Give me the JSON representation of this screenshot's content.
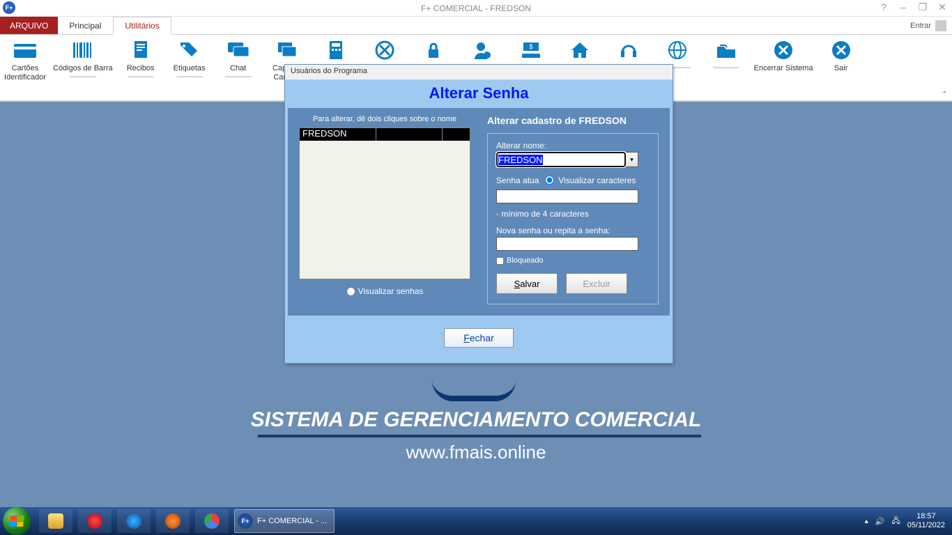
{
  "titlebar": {
    "app_logo": "F+",
    "title": "F+ COMERCIAL - FREDSON"
  },
  "win_controls": {
    "help": "?",
    "min": "–",
    "max": "❐",
    "close": "✕"
  },
  "tabs": {
    "file": "ARQUIVO",
    "principal": "Principal",
    "utilitarios": "Utilitários",
    "signin": "Entrar"
  },
  "ribbon": {
    "items": [
      {
        "label1": "Cartões",
        "label2": "Identificador"
      },
      {
        "label1": "Códigos de Barra",
        "label2": ""
      },
      {
        "label1": "Recibos",
        "label2": ""
      },
      {
        "label1": "Etiquetas",
        "label2": ""
      },
      {
        "label1": "Chat",
        "label2": ""
      },
      {
        "label1": "Capas e",
        "label2": "Cartões"
      },
      {
        "label1": "",
        "label2": ""
      },
      {
        "label1": "",
        "label2": ""
      },
      {
        "label1": "",
        "label2": ""
      },
      {
        "label1": "",
        "label2": ""
      },
      {
        "label1": "",
        "label2": ""
      },
      {
        "label1": "",
        "label2": ""
      },
      {
        "label1": "",
        "label2": ""
      },
      {
        "label1": "",
        "label2": ""
      },
      {
        "label1": "",
        "label2": ""
      },
      {
        "label1": "Encerrar Sistema",
        "label2": ""
      },
      {
        "label1": "Sair",
        "label2": ""
      }
    ],
    "sep": "----------------"
  },
  "splash": {
    "title": "SISTEMA DE GERENCIAMENTO COMERCIAL",
    "url": "www.fmais.online"
  },
  "dialog": {
    "window_title": "Usuários do Programa",
    "heading": "Alterar Senha",
    "left_hint": "Para alterar, dê dois cliques sobre o nome",
    "user_list": [
      {
        "name": "FREDSON"
      }
    ],
    "visualizar_senhas": "Visualizar senhas",
    "form_title_prefix": "Alterar cadastro de ",
    "form_title_user": "FREDSON",
    "lbl_alterar_nome": "Alterar nome:",
    "val_nome": "FREDSON",
    "lbl_senha_atual": "Senha atua",
    "lbl_visualizar_chars": "Visualizar caracteres",
    "note_min": "- mínimo de 4 caracteres",
    "lbl_nova_senha": "Nova senha ou repita a senha:",
    "lbl_bloqueado": "Bloqueado",
    "btn_salvar_u": "S",
    "btn_salvar_rest": "alvar",
    "btn_excluir": "Excluir",
    "btn_fechar_u": "F",
    "btn_fechar_rest": "echar"
  },
  "taskbar": {
    "app_label": "F+ COMERCIAL - ...",
    "time": "18:57",
    "date": "05/11/2022"
  },
  "colors": {
    "ribbon_icon": "#0b7dc4",
    "dialog_heading": "#0018ff",
    "workspace": "#6d8eb5"
  }
}
